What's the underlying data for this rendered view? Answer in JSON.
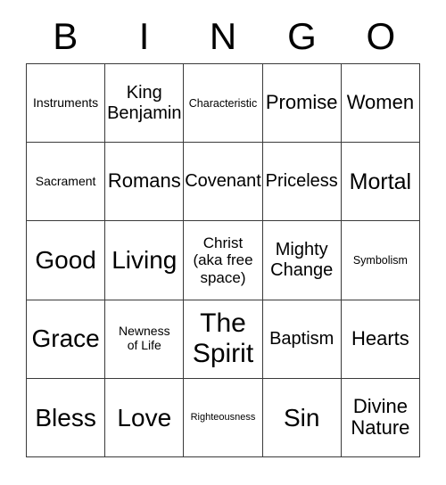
{
  "card": {
    "title": "BINGO",
    "background_color": "#ffffff",
    "text_color": "#000000",
    "border_color": "#3a3a3a"
  },
  "header": {
    "letters": [
      "B",
      "I",
      "N",
      "G",
      "O"
    ]
  },
  "grid": {
    "columns": 5,
    "rows": 5,
    "free_space_index": 12,
    "cells": [
      {
        "text": "Instruments",
        "size": "fs-m"
      },
      {
        "text": "King\nBenjamin",
        "size": "fs-l"
      },
      {
        "text": "Characteristic",
        "size": "fs-s"
      },
      {
        "text": "Promise",
        "size": "fs-xl"
      },
      {
        "text": "Women",
        "size": "fs-xl"
      },
      {
        "text": "Sacrament",
        "size": "fs-m"
      },
      {
        "text": "Romans",
        "size": "fs-xl"
      },
      {
        "text": "Covenant",
        "size": "fs-l"
      },
      {
        "text": "Priceless",
        "size": "fs-l"
      },
      {
        "text": "Mortal",
        "size": "fs-xxl"
      },
      {
        "text": "Good",
        "size": "fs-3xl"
      },
      {
        "text": "Living",
        "size": "fs-3xl"
      },
      {
        "text": "Christ\n(aka free\nspace)",
        "size": "fs-ml"
      },
      {
        "text": "Mighty\nChange",
        "size": "fs-l"
      },
      {
        "text": "Symbolism",
        "size": "fs-s"
      },
      {
        "text": "Grace",
        "size": "fs-3xl"
      },
      {
        "text": "Newness\nof Life",
        "size": "fs-m"
      },
      {
        "text": "The\nSpirit",
        "size": "fs-4xl"
      },
      {
        "text": "Baptism",
        "size": "fs-l"
      },
      {
        "text": "Hearts",
        "size": "fs-xl"
      },
      {
        "text": "Bless",
        "size": "fs-3xl"
      },
      {
        "text": "Love",
        "size": "fs-3xl"
      },
      {
        "text": "Righteousness",
        "size": "fs-xs"
      },
      {
        "text": "Sin",
        "size": "fs-3xl"
      },
      {
        "text": "Divine\nNature",
        "size": "fs-xl"
      }
    ]
  }
}
